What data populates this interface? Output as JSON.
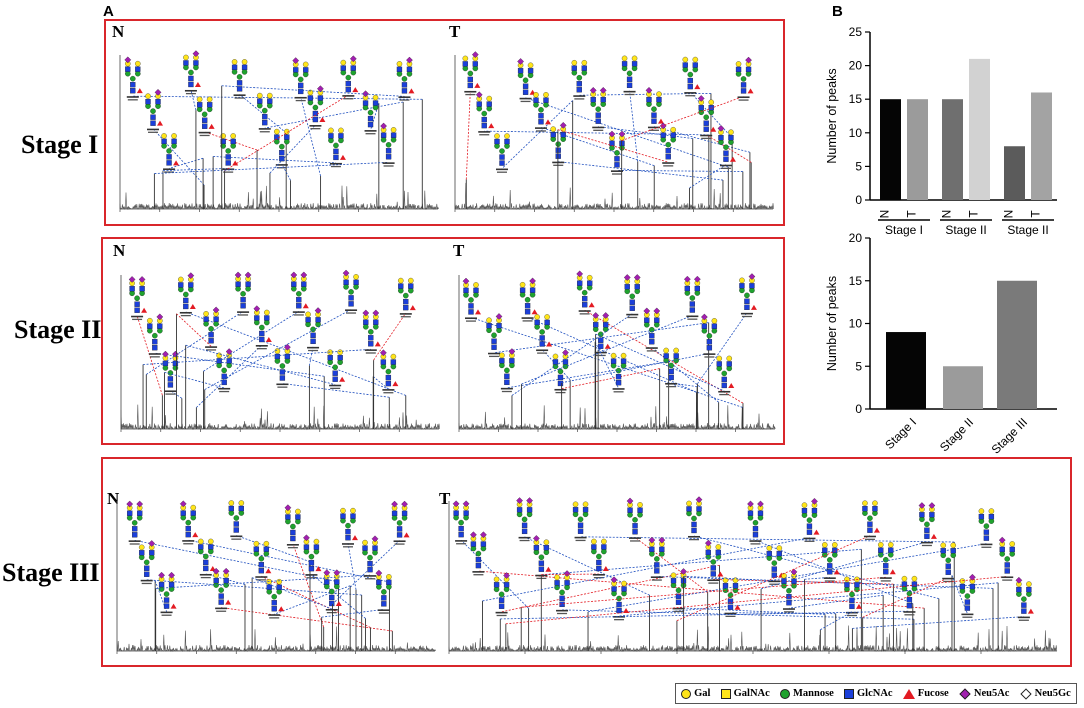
{
  "panel_labels": {
    "a": "A",
    "b": "B"
  },
  "stage_labels": [
    "Stage I",
    "Stage II",
    "Stage III"
  ],
  "spectra": {
    "s1n": {
      "letter": "N"
    },
    "s1t": {
      "letter": "T"
    },
    "s2n": {
      "letter": "N"
    },
    "s2t": {
      "letter": "T"
    },
    "s3n": {
      "letter": "N"
    },
    "s3t": {
      "letter": "T"
    }
  },
  "legend": [
    {
      "label": "Gal",
      "shape": "circle",
      "color": "#ffe51a",
      "icon": "gal-icon"
    },
    {
      "label": "GalNAc",
      "shape": "square",
      "color": "#ffe51a",
      "icon": "galnac-icon"
    },
    {
      "label": "Mannose",
      "shape": "circle",
      "color": "#1fa22e",
      "icon": "mannose-icon"
    },
    {
      "label": "GlcNAc",
      "shape": "square",
      "color": "#1b3fd9",
      "icon": "glcnac-icon"
    },
    {
      "label": "Fucose",
      "shape": "triangle",
      "color": "#e31b23",
      "icon": "fucose-icon"
    },
    {
      "label": "Neu5Ac",
      "shape": "diamond",
      "color": "#a21fb0",
      "icon": "neu5ac-icon"
    },
    {
      "label": "Neu5Gc",
      "shape": "diamond",
      "color": "#ffffff",
      "icon": "neu5gc-icon"
    }
  ],
  "chart_data": [
    {
      "type": "bar",
      "ylabel": "Number of  peaks",
      "categories": [
        "N",
        "T",
        "N",
        "T",
        "N",
        "T"
      ],
      "groups": [
        "Stage I",
        "Stage II",
        "Stage II"
      ],
      "values": [
        15,
        15,
        15,
        21,
        8,
        16
      ],
      "colors": [
        "#050505",
        "#9b9b9b",
        "#6f6f6f",
        "#d2d2d2",
        "#5b5b5b",
        "#a3a3a3"
      ],
      "ylim": [
        0,
        25
      ],
      "yticks": [
        0,
        5,
        10,
        15,
        20,
        25
      ]
    },
    {
      "type": "bar",
      "ylabel": "Number of  peaks",
      "categories": [
        "Stage I",
        "Stage II",
        "Stage III"
      ],
      "values": [
        9,
        5,
        15
      ],
      "colors": [
        "#050505",
        "#9b9b9b",
        "#7a7a7a"
      ],
      "ylim": [
        0,
        20
      ],
      "yticks": [
        0,
        5,
        10,
        15,
        20
      ]
    }
  ]
}
